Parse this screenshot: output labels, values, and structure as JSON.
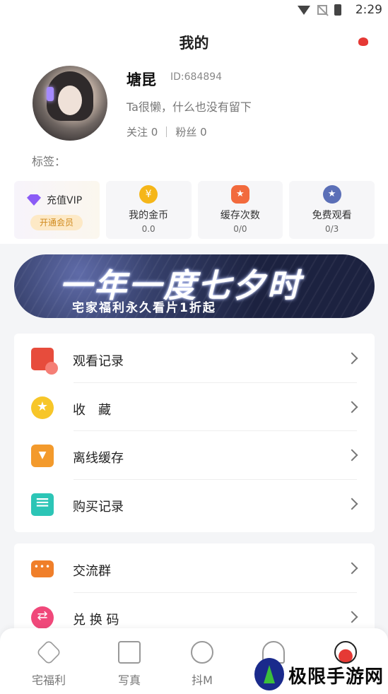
{
  "status": {
    "time": "2:29"
  },
  "header": {
    "title": "我的"
  },
  "profile": {
    "name": "塘昆",
    "id": "ID:684894",
    "bio": "Ta很懒，什么也没有留下",
    "following": "关注 0",
    "followers": "粉丝 0",
    "tags_label": "标签："
  },
  "cards": {
    "vip": {
      "label": "充值VIP",
      "button": "开通会员"
    },
    "coins": {
      "label": "我的金币",
      "value": "0.0"
    },
    "cache": {
      "label": "缓存次数",
      "value": "0/0"
    },
    "free": {
      "label": "免费观看",
      "value": "0/3"
    }
  },
  "banner": {
    "title": "一年一度七夕时",
    "subtitle": "宅家福利永久看片1折起"
  },
  "menu1": [
    {
      "label": "观看记录",
      "icon": "history-icon"
    },
    {
      "label": "收　藏",
      "icon": "favorite-star-icon"
    },
    {
      "label": "离线缓存",
      "icon": "offline-download-icon"
    },
    {
      "label": "购买记录",
      "icon": "purchase-list-icon"
    }
  ],
  "menu2": [
    {
      "label": "交流群",
      "icon": "chat-group-icon"
    },
    {
      "label": "兑 换 码",
      "icon": "exchange-code-icon"
    }
  ],
  "tabbar": [
    {
      "label": "宅福利",
      "icon": "home-icon"
    },
    {
      "label": "写真",
      "icon": "image-icon"
    },
    {
      "label": "抖M",
      "icon": "music-icon"
    },
    {
      "label": "",
      "icon": "heart-pulse-icon"
    },
    {
      "label": "",
      "icon": "mine-icon"
    }
  ],
  "watermark": {
    "text": "极限手游网"
  },
  "colors": {
    "accent_red": "#e53935",
    "vip_purple": "#8b5cf6",
    "coin_gold": "#f5b619"
  }
}
